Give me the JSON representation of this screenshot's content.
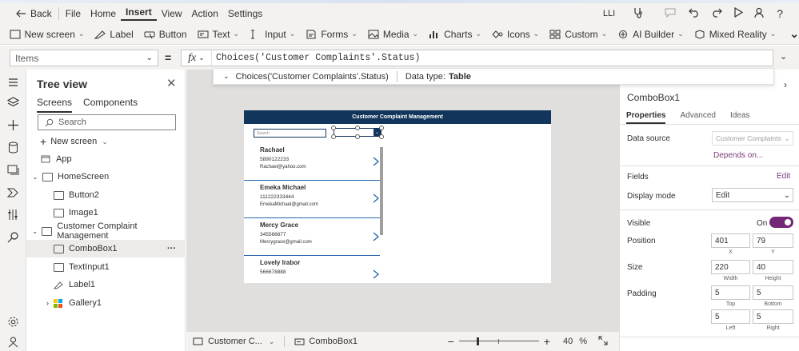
{
  "menu": {
    "back": "Back",
    "items": [
      "File",
      "Home",
      "Insert",
      "View",
      "Action",
      "Settings"
    ],
    "active": "Insert",
    "user": "LLI"
  },
  "ribbon": [
    "New screen",
    "Label",
    "Button",
    "Text",
    "Input",
    "Forms",
    "Media",
    "Charts",
    "Icons",
    "Custom",
    "AI Builder",
    "Mixed Reality"
  ],
  "formula": {
    "property": "Items",
    "fx": "fx",
    "expression": "Choices('Customer Complaints'.Status)",
    "hint_expr": "Choices('Customer Complaints'.Status)",
    "hint_type_label": "Data type:",
    "hint_type": "Table"
  },
  "tree": {
    "title": "Tree view",
    "tabs": [
      "Screens",
      "Components"
    ],
    "search_placeholder": "Search",
    "new_screen": "New screen",
    "items": [
      {
        "label": "App",
        "indent": 0,
        "expander": ""
      },
      {
        "label": "HomeScreen",
        "indent": 0,
        "expander": "v"
      },
      {
        "label": "Button2",
        "indent": 1,
        "expander": ""
      },
      {
        "label": "Image1",
        "indent": 1,
        "expander": ""
      },
      {
        "label": "Customer Complaint Management",
        "indent": 0,
        "expander": "v"
      },
      {
        "label": "ComboBox1",
        "indent": 1,
        "expander": ""
      },
      {
        "label": "TextInput1",
        "indent": 1,
        "expander": ""
      },
      {
        "label": "Label1",
        "indent": 1,
        "expander": ""
      },
      {
        "label": "Gallery1",
        "indent": 1,
        "expander": ">"
      }
    ],
    "selected": "ComboBox1",
    "more": "···"
  },
  "app": {
    "header": "Customer Complaint Management",
    "search_placeholder": "Search",
    "gallery": [
      {
        "name": "Rachael",
        "phone": "5890122233",
        "email": "Rachael@yahoo.com"
      },
      {
        "name": "Emeka Michael",
        "phone": "111222333444",
        "email": "EmekaMichael@gmail.com"
      },
      {
        "name": "Mercy Grace",
        "phone": "345566677",
        "email": "Mercygrace@gmail.com"
      },
      {
        "name": "Lovely Irabor",
        "phone": "566678888",
        "email": ""
      }
    ]
  },
  "bottom": {
    "screen": "Customer C...",
    "control": "ComboBox1",
    "zoom": "40",
    "zoom_unit": "%"
  },
  "props": {
    "name": "ComboBox1",
    "tabs": [
      "Properties",
      "Advanced",
      "Ideas"
    ],
    "data_source_label": "Data source",
    "data_source_value": "Customer Complaints",
    "depends_on": "Depends on...",
    "fields_label": "Fields",
    "fields_edit": "Edit",
    "display_mode_label": "Display mode",
    "display_mode_value": "Edit",
    "visible_label": "Visible",
    "visible_value": "On",
    "position_label": "Position",
    "x": "401",
    "y": "79",
    "x_label": "X",
    "y_label": "Y",
    "size_label": "Size",
    "width": "220",
    "height": "40",
    "width_label": "Width",
    "height_label": "Height",
    "padding_label": "Padding",
    "pad_top": "5",
    "pad_bottom": "5",
    "pad_left": "5",
    "pad_right": "5",
    "top_label": "Top",
    "bottom_label": "Bottom",
    "left_label": "Left",
    "right_label": "Right"
  }
}
